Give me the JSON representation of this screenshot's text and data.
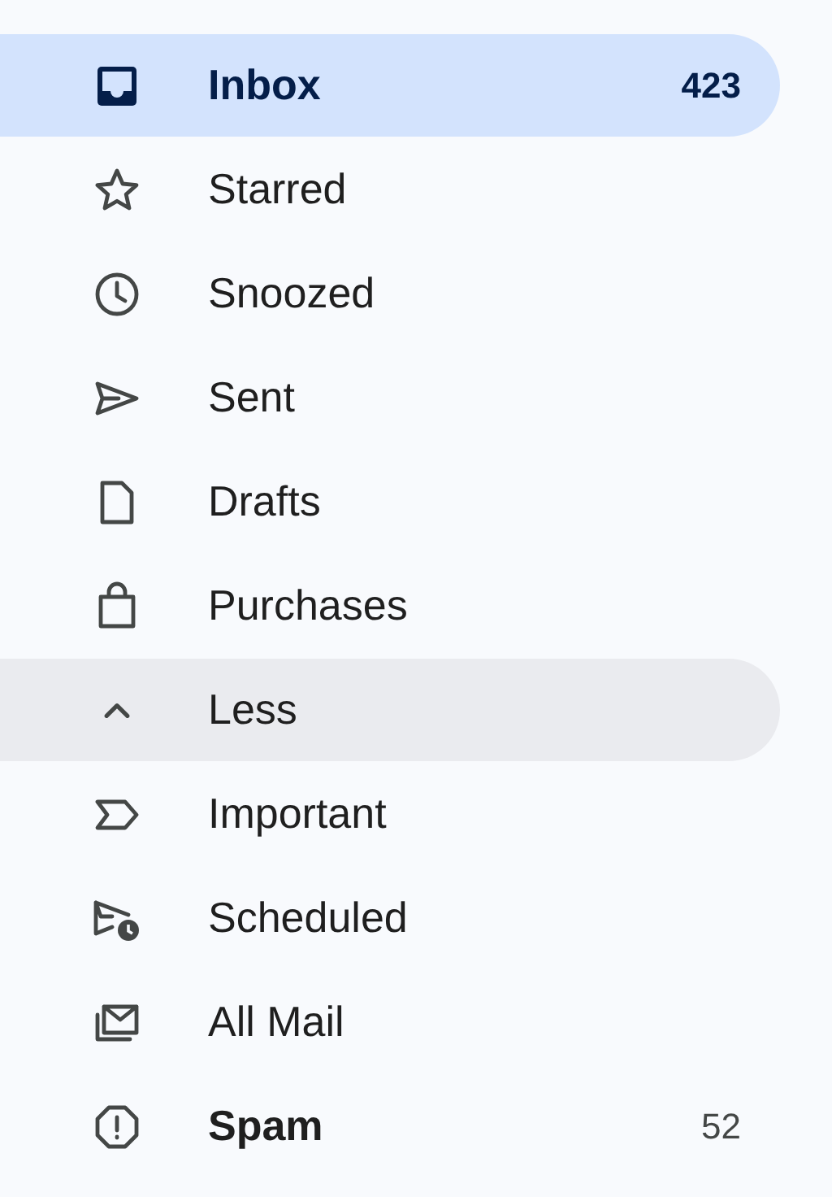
{
  "nav": {
    "items": [
      {
        "label": "Inbox",
        "count": "423",
        "selected": true,
        "hovered": false,
        "unread": true
      },
      {
        "label": "Starred",
        "selected": false,
        "hovered": false,
        "unread": false
      },
      {
        "label": "Snoozed",
        "selected": false,
        "hovered": false,
        "unread": false
      },
      {
        "label": "Sent",
        "selected": false,
        "hovered": false,
        "unread": false
      },
      {
        "label": "Drafts",
        "selected": false,
        "hovered": false,
        "unread": false
      },
      {
        "label": "Purchases",
        "selected": false,
        "hovered": false,
        "unread": false
      },
      {
        "label": "Less",
        "selected": false,
        "hovered": true,
        "unread": false
      },
      {
        "label": "Important",
        "selected": false,
        "hovered": false,
        "unread": false
      },
      {
        "label": "Scheduled",
        "selected": false,
        "hovered": false,
        "unread": false
      },
      {
        "label": "All Mail",
        "selected": false,
        "hovered": false,
        "unread": false
      },
      {
        "label": "Spam",
        "count": "52",
        "selected": false,
        "hovered": false,
        "unread": true
      }
    ]
  }
}
